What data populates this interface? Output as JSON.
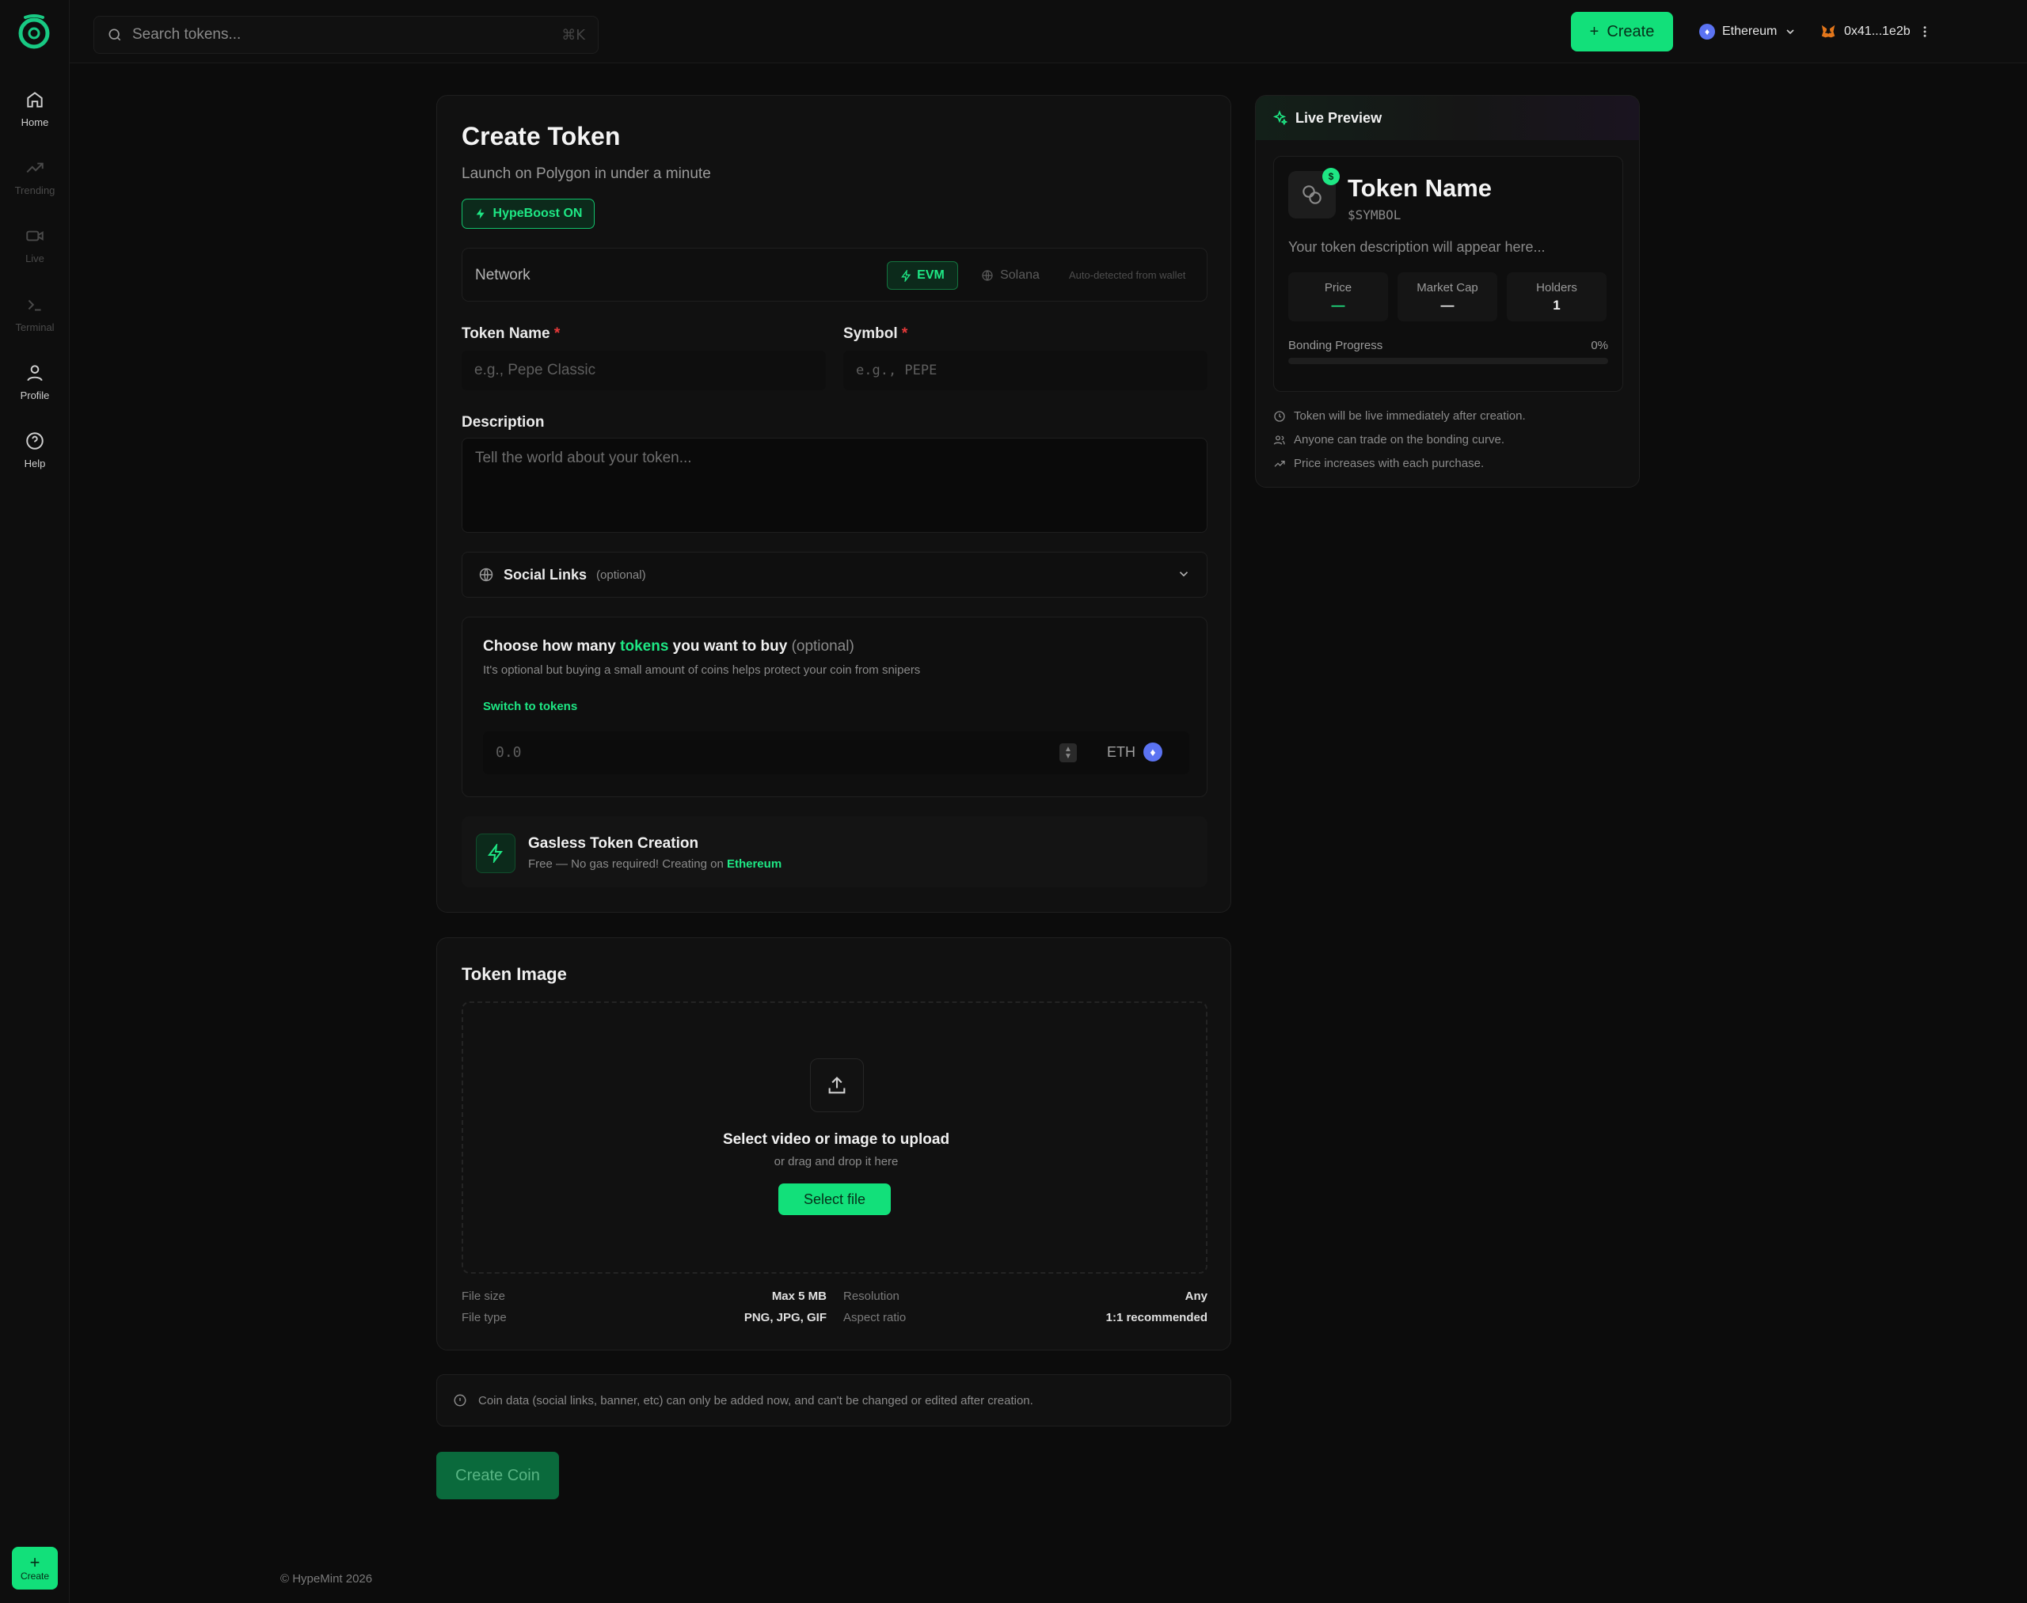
{
  "sidebar": {
    "items": [
      {
        "label": "Home",
        "icon": "home-icon"
      },
      {
        "label": "Trending",
        "icon": "trending-icon"
      },
      {
        "label": "Live",
        "icon": "video-icon"
      },
      {
        "label": "Terminal",
        "icon": "terminal-icon"
      },
      {
        "label": "Profile",
        "icon": "user-icon"
      },
      {
        "label": "Help",
        "icon": "help-icon"
      }
    ],
    "create_label": "Create"
  },
  "topbar": {
    "search_placeholder": "Search tokens...",
    "search_shortcut": "⌘K",
    "create_label": "Create",
    "network": "Ethereum",
    "wallet": "0x41...1e2b"
  },
  "form": {
    "title": "Create Token",
    "subtitle": "Launch on Polygon in under a minute",
    "hypeboost": "HypeBoost ON",
    "network_label": "Network",
    "network_evm": "EVM",
    "network_solana": "Solana",
    "network_note": "Auto-detected from wallet",
    "token_name_label": "Token Name",
    "token_name_placeholder": "e.g., Pepe Classic",
    "symbol_label": "Symbol",
    "symbol_placeholder": "e.g., PEPE",
    "required_mark": "*",
    "description_label": "Description",
    "description_placeholder": "Tell the world about your token...",
    "social_title": "Social Links",
    "social_optional": "(optional)",
    "buy_title_pre": "Choose how many",
    "buy_title_accent": "tokens",
    "buy_title_post": "you want to buy",
    "buy_optional": "(optional)",
    "buy_sub": "It's optional but buying a small amount of coins helps protect your coin from snipers",
    "switch_label": "Switch to tokens",
    "amount_placeholder": "0.0",
    "amount_currency": "ETH",
    "gasless_title": "Gasless Token Creation",
    "gasless_sub": "Free — No gas required! Creating on",
    "gasless_chain": "Ethereum"
  },
  "image": {
    "title": "Token Image",
    "drop_title": "Select video or image to upload",
    "drop_sub": "or drag and drop it here",
    "select_label": "Select file",
    "meta": {
      "file_size_k": "File size",
      "file_size_v": "Max 5 MB",
      "file_type_k": "File type",
      "file_type_v": "PNG, JPG, GIF",
      "resolution_k": "Resolution",
      "resolution_v": "Any",
      "aspect_k": "Aspect ratio",
      "aspect_v": "1:1 recommended"
    }
  },
  "notice": "Coin data (social links, banner, etc) can only be added now, and can't be changed or edited after creation.",
  "submit_label": "Create Coin",
  "footer": "© HypeMint 2026",
  "preview": {
    "title": "Live Preview",
    "name": "Token Name",
    "symbol": "$SYMBOL",
    "description": "Your token description will appear here...",
    "price_k": "Price",
    "price_v": "—",
    "mcap_k": "Market Cap",
    "mcap_v": "—",
    "holders_k": "Holders",
    "holders_v": "1",
    "bonding_k": "Bonding Progress",
    "bonding_v": "0%",
    "bonding_progress": 0,
    "notes": [
      "Token will be live immediately after creation.",
      "Anyone can trade on the bonding curve.",
      "Price increases with each purchase."
    ]
  },
  "colors": {
    "accent": "#12e07a",
    "background": "#0c0c0c",
    "eth": "#5b73f2"
  }
}
